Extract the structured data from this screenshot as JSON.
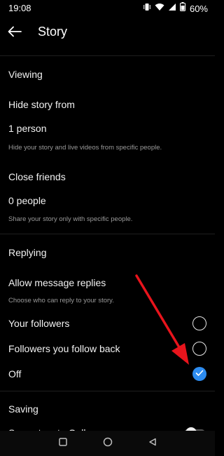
{
  "status_bar": {
    "time": "19:08",
    "battery": "60%",
    "icons": [
      "vibrate-icon",
      "wifi-icon",
      "signal-icon",
      "battery-icon"
    ]
  },
  "header": {
    "title": "Story",
    "back_icon": "arrow-left-icon"
  },
  "viewing": {
    "section_title": "Viewing",
    "hide_story": {
      "title": "Hide story from",
      "value": "1 person",
      "description": "Hide your story and live videos from specific people."
    },
    "close_friends": {
      "title": "Close friends",
      "value": "0 people",
      "description": "Share your story only with specific people."
    }
  },
  "replying": {
    "section_title": "Replying",
    "title": "Allow message replies",
    "description": "Choose who can reply to your story.",
    "options": [
      {
        "label": "Your followers",
        "checked": false
      },
      {
        "label": "Followers you follow back",
        "checked": false
      },
      {
        "label": "Off",
        "checked": true
      }
    ]
  },
  "saving": {
    "section_title": "Saving",
    "partial_item": "Save story to Gallery",
    "toggle_on": false
  },
  "colors": {
    "background": "#000000",
    "accent": "#2d8cf0",
    "annotation": "#e8141c",
    "secondary_text": "#9a9a9a"
  },
  "nav_bar": {
    "icons": [
      "recents-square-icon",
      "home-circle-icon",
      "back-triangle-icon"
    ]
  }
}
